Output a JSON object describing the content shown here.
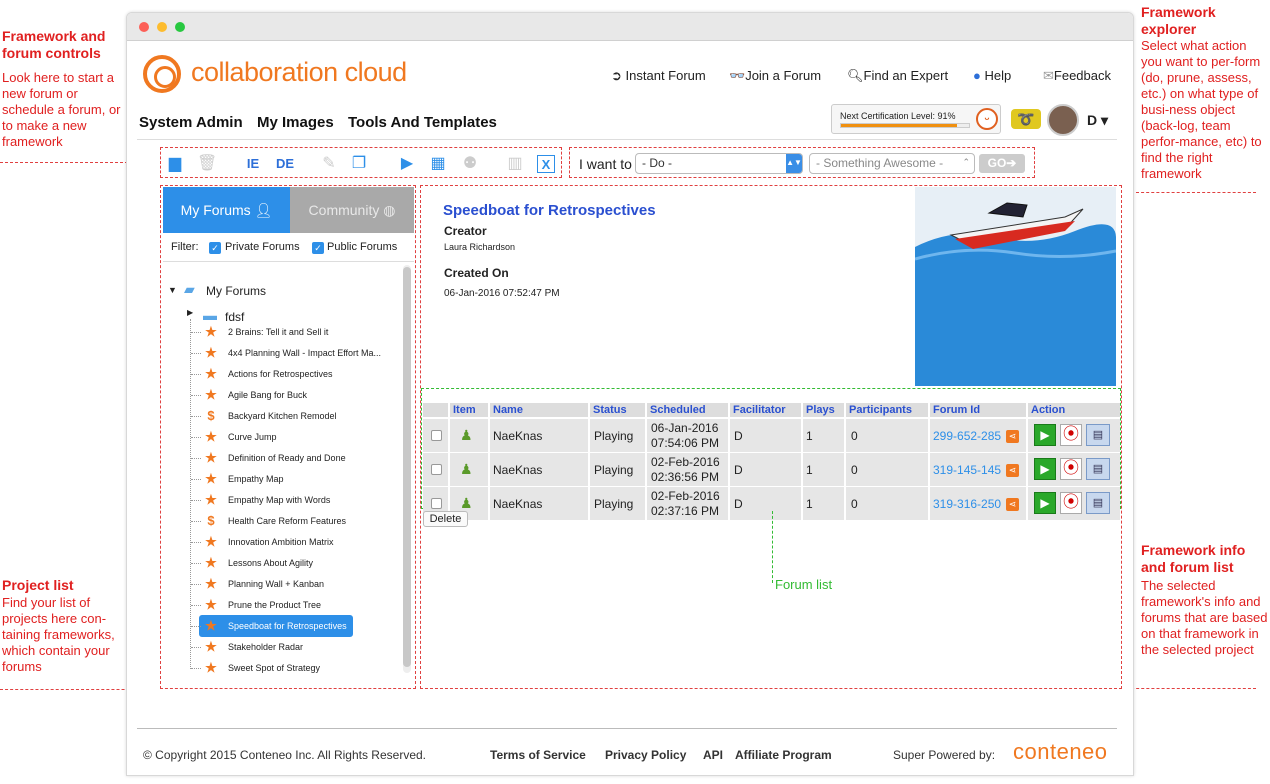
{
  "callouts": {
    "controls": {
      "title": "Framework and forum controls",
      "body": "Look here to start a new forum or schedule a forum, or to make a new framework"
    },
    "explorer": {
      "title": "Framework explorer",
      "body": "Select what action you want to per-form (do, prune, assess, etc.) on what type of busi-ness object (back-log, team perfor-mance, etc) to find the right framework"
    },
    "project": {
      "title": "Project list",
      "body": "Find your list of projects here con-taining frameworks, which contain your forums"
    },
    "info": {
      "title": "Framework info and forum list",
      "body": "The selected framework's info and forums that are based on that framework in the selected project"
    },
    "forum_list": "Forum list"
  },
  "header": {
    "logo_text": "collaboration cloud",
    "links": [
      "Instant Forum",
      "Join a Forum",
      "Find an Expert",
      "Help",
      "Feedback"
    ],
    "menu": [
      "System Admin",
      "My Images",
      "Tools And Templates"
    ],
    "cert_label": "Next Certification Level: 91%",
    "cert_progress": 0.91,
    "user_initial": "D ▾"
  },
  "explorer": {
    "label": "I want to",
    "action": "- Do -",
    "object": "- Something Awesome -",
    "go": "GO➔"
  },
  "sidebar": {
    "tab_active": "My Forums",
    "tab_inactive": "Community",
    "filter_label": "Filter:",
    "filter_private": "Private Forums",
    "filter_public": "Public Forums",
    "root": "My Forums",
    "folder": "fdsf",
    "items": [
      {
        "label": "2 Brains: Tell it and Sell it",
        "icon": "star"
      },
      {
        "label": "4x4 Planning Wall - Impact Effort Ma...",
        "icon": "star"
      },
      {
        "label": "Actions for Retrospectives",
        "icon": "star"
      },
      {
        "label": "Agile Bang for Buck",
        "icon": "star"
      },
      {
        "label": "Backyard Kitchen Remodel",
        "icon": "dollar"
      },
      {
        "label": "Curve Jump",
        "icon": "star"
      },
      {
        "label": "Definition of Ready and Done",
        "icon": "star"
      },
      {
        "label": "Empathy Map",
        "icon": "star"
      },
      {
        "label": "Empathy Map with Words",
        "icon": "star"
      },
      {
        "label": "Health Care Reform Features",
        "icon": "dollar"
      },
      {
        "label": "Innovation Ambition Matrix",
        "icon": "star"
      },
      {
        "label": "Lessons About Agility",
        "icon": "star"
      },
      {
        "label": "Planning Wall + Kanban",
        "icon": "star"
      },
      {
        "label": "Prune the Product Tree",
        "icon": "star"
      },
      {
        "label": "Speedboat for Retrospectives",
        "icon": "star"
      },
      {
        "label": "Stakeholder Radar",
        "icon": "star"
      },
      {
        "label": "Sweet Spot of Strategy",
        "icon": "star"
      }
    ],
    "selected_index": 14
  },
  "info": {
    "title": "Speedboat for Retrospectives",
    "creator_label": "Creator",
    "creator": "Laura Richardson",
    "created_label": "Created On",
    "created": "06-Jan-2016 07:52:47 PM"
  },
  "table": {
    "headers": [
      "Item",
      "Name",
      "Status",
      "Scheduled",
      "Facilitator",
      "Plays",
      "Participants",
      "Forum Id",
      "Action"
    ],
    "rows": [
      {
        "name": "NaeKnas",
        "status": "Playing",
        "date": "06-Jan-2016",
        "time": "07:54:06 PM",
        "facilitator": "D",
        "plays": "1",
        "participants": "0",
        "forum_id": "299-652-285"
      },
      {
        "name": "NaeKnas",
        "status": "Playing",
        "date": "02-Feb-2016",
        "time": "02:36:56 PM",
        "facilitator": "D",
        "plays": "1",
        "participants": "0",
        "forum_id": "319-145-145"
      },
      {
        "name": "NaeKnas",
        "status": "Playing",
        "date": "02-Feb-2016",
        "time": "02:37:16 PM",
        "facilitator": "D",
        "plays": "1",
        "participants": "0",
        "forum_id": "319-316-250"
      }
    ],
    "delete": "Delete"
  },
  "footer": {
    "copyright": "© Copyright 2015 Conteneo Inc. All Rights Reserved.",
    "links": [
      "Terms of Service",
      "Privacy Policy",
      "API",
      "Affiliate Program"
    ],
    "powered": "Super Powered by:",
    "brand": "conteneo"
  },
  "colors": {
    "accent": "#2d8fe8",
    "brand": "#f07820",
    "callout": "#e02020",
    "forum_list": "#33bb33"
  }
}
